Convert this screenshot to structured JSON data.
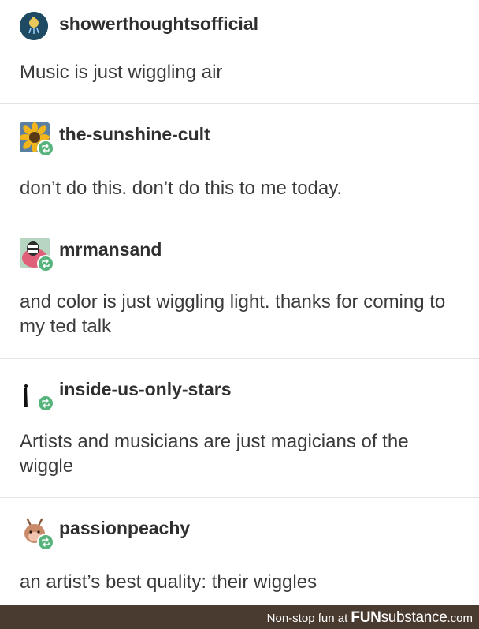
{
  "posts": [
    {
      "username": "showerthoughtsofficial",
      "text": "Music is just wiggling air",
      "avatar_icon": "shower-head-icon",
      "reblog": false
    },
    {
      "username": "the-sunshine-cult",
      "text": "don’t do this. don’t do this to me today.",
      "avatar_icon": "sunflower-icon",
      "reblog": true
    },
    {
      "username": "mrmansand",
      "text": "and color is just wiggling light. thanks for coming to my ted talk",
      "avatar_icon": "character-icon",
      "reblog": true
    },
    {
      "username": "inside-us-only-stars",
      "text": "Artists and musicians are just magicians of the wiggle",
      "avatar_icon": "figure-icon",
      "reblog": true
    },
    {
      "username": "passionpeachy",
      "text": "an artist’s best quality: their wiggles",
      "avatar_icon": "deer-icon",
      "reblog": true
    }
  ],
  "footer": {
    "tagline": "Non-stop fun at",
    "brand_prefix": "FUN",
    "brand_suffix": "substance",
    "brand_tld": ".com"
  },
  "colors": {
    "reblog_badge": "#56b37c",
    "footer_bg": "#4a3b30",
    "divider": "#e3e3e3"
  }
}
